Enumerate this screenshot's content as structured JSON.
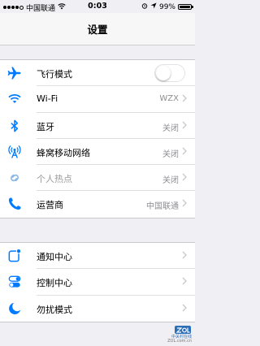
{
  "colors": {
    "accent": "#007aff",
    "background": "#efeff4"
  },
  "status_bar": {
    "carrier": "中国联通",
    "time": "0:03",
    "battery": "99%",
    "battery_level": 0.99
  },
  "nav": {
    "title": "设置"
  },
  "group1": [
    {
      "icon": "airplane-icon",
      "label": "飞行模式",
      "control": "toggle",
      "toggle_on": false
    },
    {
      "icon": "wifi-icon",
      "label": "Wi-Fi",
      "value": "WZX"
    },
    {
      "icon": "bluetooth-icon",
      "label": "蓝牙",
      "value": "关闭"
    },
    {
      "icon": "cellular-icon",
      "label": "蜂窝移动网络",
      "value": "关闭"
    },
    {
      "icon": "hotspot-icon",
      "label": "个人热点",
      "value": "关闭",
      "dimmed": true
    },
    {
      "icon": "phone-icon",
      "label": "运营商",
      "value": "中国联通"
    }
  ],
  "group2": [
    {
      "icon": "notification-center-icon",
      "label": "通知中心"
    },
    {
      "icon": "control-center-icon",
      "label": "控制中心"
    },
    {
      "icon": "moon-icon",
      "label": "勿扰模式"
    }
  ],
  "watermark": {
    "brand": "中关村在线",
    "url": "ZOL.com.cn"
  }
}
